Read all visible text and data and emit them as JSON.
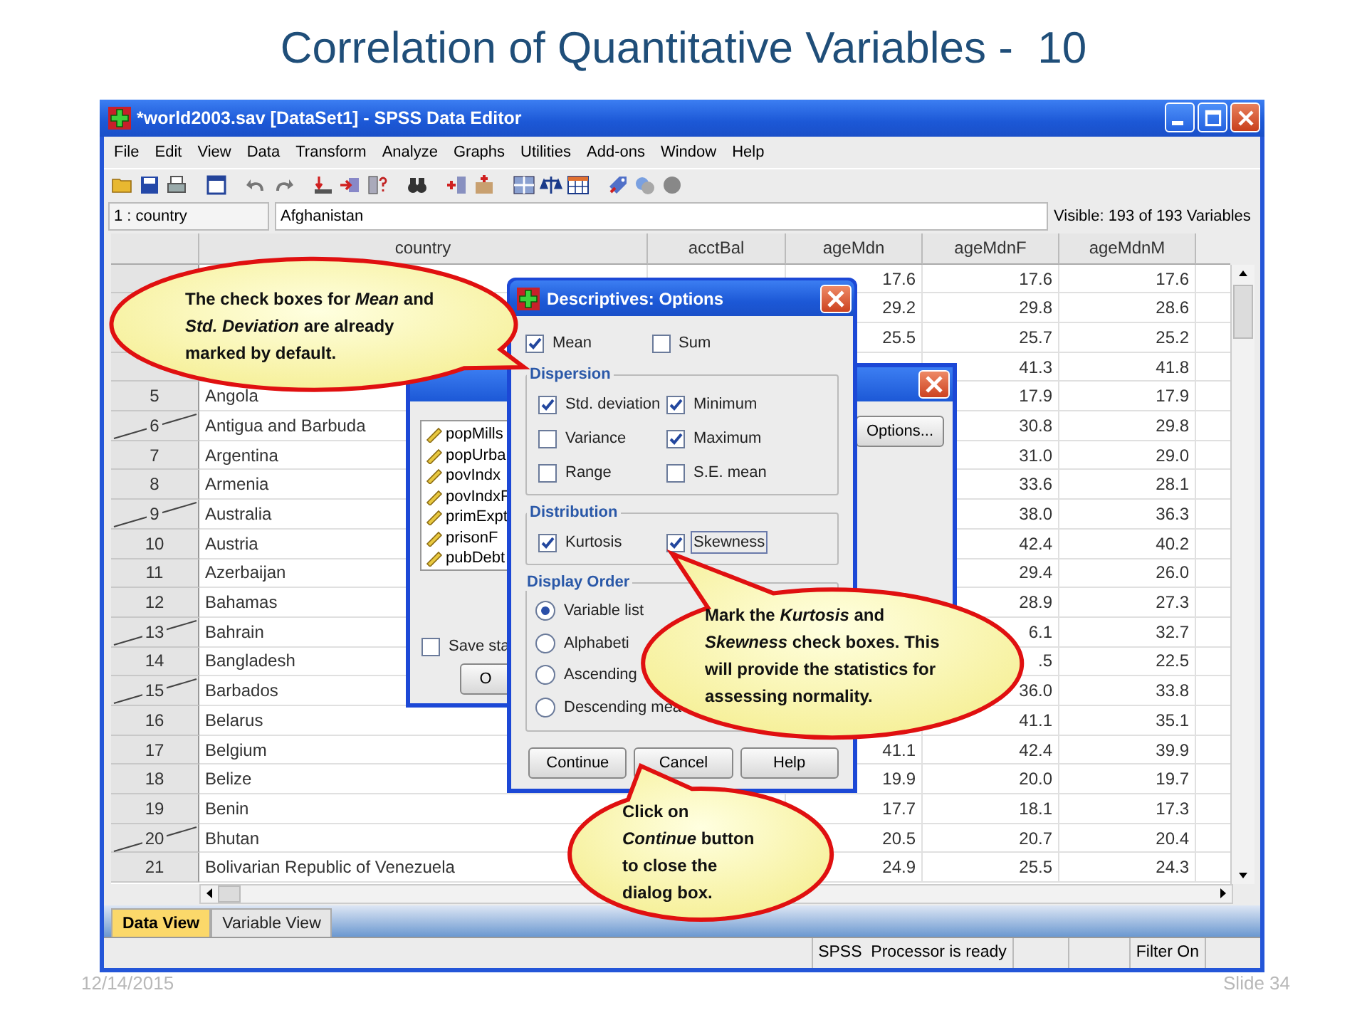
{
  "slide": {
    "title": "Correlation of Quantitative Variables -  10",
    "date": "12/14/2015",
    "slide_number": "Slide 34"
  },
  "window": {
    "title": "*world2003.sav [DataSet1] - SPSS Data Editor",
    "menu": [
      "File",
      "Edit",
      "View",
      "Data",
      "Transform",
      "Analyze",
      "Graphs",
      "Utilities",
      "Add-ons",
      "Window",
      "Help"
    ],
    "cell_ref": "1 : country",
    "cell_value": "Afghanistan",
    "visible_info": "Visible: 193 of 193 Variables"
  },
  "grid": {
    "columns": [
      "country",
      "acctBal",
      "ageMdn",
      "ageMdnF",
      "ageMdnM"
    ],
    "rows": [
      {
        "filtered": false,
        "cells": [
          null,
          null,
          "17.6",
          "17.6",
          "17.6"
        ]
      },
      {
        "filtered": false,
        "cells": [
          null,
          null,
          "29.2",
          "29.8",
          "28.6"
        ]
      },
      {
        "filtered": false,
        "cells": [
          null,
          null,
          "25.5",
          "25.7",
          "25.2"
        ]
      },
      {
        "filtered": false,
        "cells": [
          null,
          null,
          null,
          "41.3",
          "41.8"
        ]
      },
      {
        "number": "5",
        "filtered": false,
        "cells": [
          "Angola",
          null,
          null,
          "17.9",
          "17.9"
        ]
      },
      {
        "number": "6",
        "filtered": true,
        "cells": [
          "Antigua and Barbuda",
          null,
          null,
          "30.8",
          "29.8"
        ]
      },
      {
        "number": "7",
        "filtered": false,
        "cells": [
          "Argentina",
          null,
          null,
          "31.0",
          "29.0"
        ]
      },
      {
        "number": "8",
        "filtered": false,
        "cells": [
          "Armenia",
          null,
          null,
          "33.6",
          "28.1"
        ]
      },
      {
        "number": "9",
        "filtered": true,
        "cells": [
          "Australia",
          null,
          null,
          "38.0",
          "36.3"
        ]
      },
      {
        "number": "10",
        "filtered": false,
        "cells": [
          "Austria",
          null,
          null,
          "42.4",
          "40.2"
        ]
      },
      {
        "number": "11",
        "filtered": false,
        "cells": [
          "Azerbaijan",
          null,
          null,
          "29.4",
          "26.0"
        ]
      },
      {
        "number": "12",
        "filtered": false,
        "cells": [
          "Bahamas",
          null,
          null,
          "28.9",
          "27.3"
        ]
      },
      {
        "number": "13",
        "filtered": true,
        "cells": [
          "Bahrain",
          null,
          null,
          "6.1",
          "32.7"
        ]
      },
      {
        "number": "14",
        "filtered": false,
        "cells": [
          "Bangladesh",
          null,
          null,
          ".5",
          "22.5"
        ]
      },
      {
        "number": "15",
        "filtered": true,
        "cells": [
          "Barbados",
          null,
          null,
          "36.0",
          "33.8"
        ]
      },
      {
        "number": "16",
        "filtered": false,
        "cells": [
          "Belarus",
          null,
          null,
          "41.1",
          "35.1"
        ]
      },
      {
        "number": "17",
        "filtered": false,
        "cells": [
          "Belgium",
          null,
          "41.1",
          "42.4",
          "39.9"
        ]
      },
      {
        "number": "18",
        "filtered": false,
        "cells": [
          "Belize",
          null,
          "19.9",
          "20.0",
          "19.7"
        ]
      },
      {
        "number": "19",
        "filtered": false,
        "cells": [
          "Benin",
          null,
          "17.7",
          "18.1",
          "17.3"
        ]
      },
      {
        "number": "20",
        "filtered": true,
        "cells": [
          "Bhutan",
          null,
          "20.5",
          "20.7",
          "20.4"
        ]
      },
      {
        "number": "21",
        "filtered": false,
        "cells": [
          "Bolivarian Republic of Venezuela",
          null,
          "24.9",
          "25.5",
          "24.3"
        ]
      }
    ]
  },
  "view_tabs": [
    {
      "label": "Data View",
      "selected": true
    },
    {
      "label": "Variable View",
      "selected": false
    }
  ],
  "status_bar": {
    "processor": "SPSS  Processor is ready",
    "filter": "Filter On"
  },
  "descriptives_dialog": {
    "variables": [
      "popMills",
      "popUrba",
      "povIndx",
      "povIndxF",
      "primExpt",
      "prisonF",
      "pubDebt"
    ],
    "save_checkbox": {
      "label": "Save sta",
      "checked": false
    },
    "ok_button": "O",
    "options_button": "Options..."
  },
  "options_dialog": {
    "title": "Descriptives: Options",
    "top": [
      {
        "label": "Mean",
        "checked": true
      },
      {
        "label": "Sum",
        "checked": false
      }
    ],
    "groups": [
      {
        "title": "Dispersion",
        "items": [
          {
            "label": "Std. deviation",
            "checked": true
          },
          {
            "label": "Minimum",
            "checked": true
          },
          {
            "label": "Variance",
            "checked": false
          },
          {
            "label": "Maximum",
            "checked": true
          },
          {
            "label": "Range",
            "checked": false
          },
          {
            "label": "S.E. mean",
            "checked": false
          }
        ]
      },
      {
        "title": "Distribution",
        "items": [
          {
            "label": "Kurtosis",
            "checked": true,
            "focused": false
          },
          {
            "label": "Skewness",
            "checked": true,
            "focused": true
          }
        ]
      }
    ],
    "display_order": {
      "title": "Display Order",
      "options": [
        {
          "label": "Variable list",
          "selected": true
        },
        {
          "label": "Alphabeti",
          "selected": false
        },
        {
          "label": "Ascending",
          "selected": false
        },
        {
          "label": "Descending mea",
          "selected": false
        }
      ]
    },
    "buttons": [
      "Continue",
      "Cancel",
      "Help"
    ]
  },
  "callouts": [
    {
      "text": "The check boxes for *Mean* and *Std. Deviation* are already marked by default."
    },
    {
      "text": "Mark the *Kurtosis* and *Skewness* check boxes. This will provide the statistics for assessing normality."
    },
    {
      "text": "Click on *Continue* button to close the dialog box."
    }
  ]
}
